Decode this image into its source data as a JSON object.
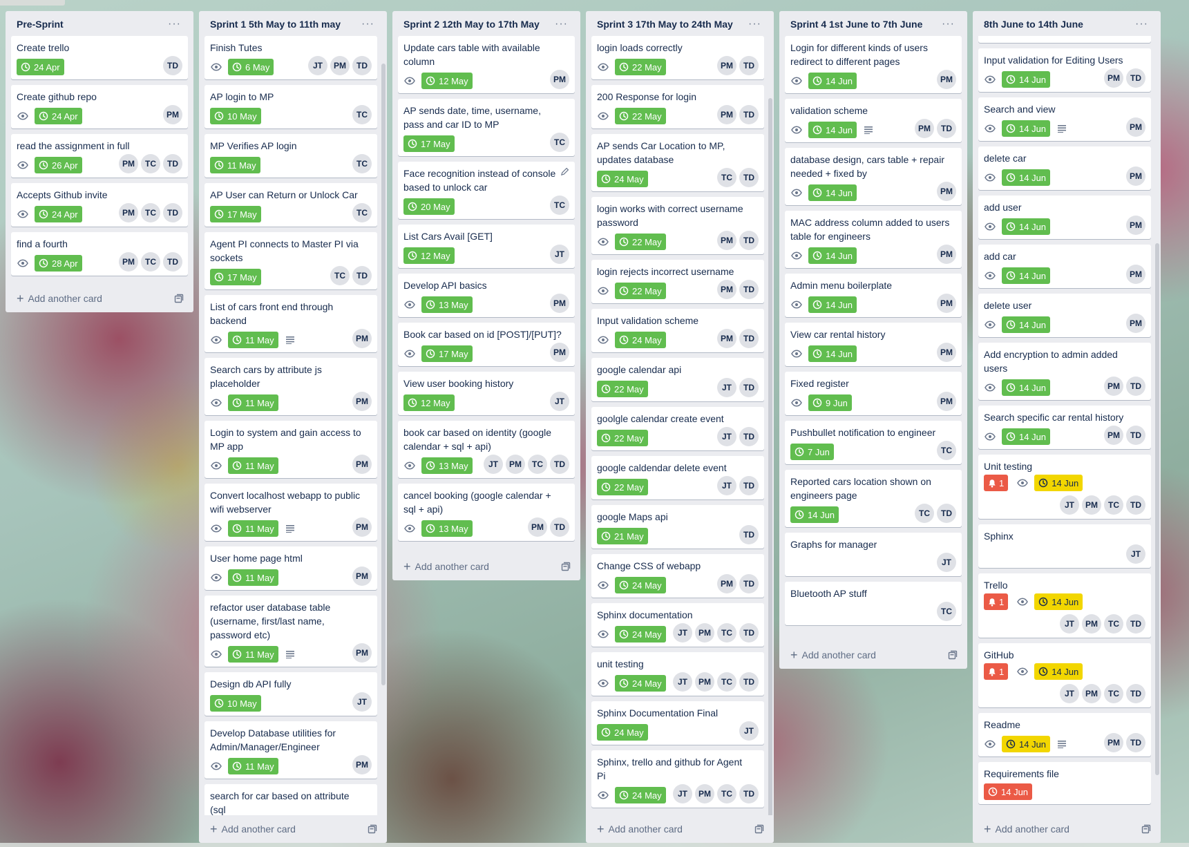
{
  "colors": {
    "list_bg": "#ebecf0",
    "due_green": "#61bd4f",
    "due_yellow": "#f2d600",
    "due_red": "#eb5a46",
    "member_bg": "#dfe1e6"
  },
  "add_card_label": "Add another card",
  "lists": [
    {
      "title": "Pre-Sprint",
      "cards": [
        {
          "title": "Create trello",
          "watch": false,
          "due": {
            "label": "24 Apr",
            "color": "green"
          },
          "members": [
            "TD"
          ]
        },
        {
          "title": "Create github repo",
          "watch": true,
          "due": {
            "label": "24 Apr",
            "color": "green"
          },
          "members": [
            "PM"
          ]
        },
        {
          "title": "read the assignment in full",
          "watch": true,
          "due": {
            "label": "26 Apr",
            "color": "green"
          },
          "members": [
            "PM",
            "TC",
            "TD"
          ]
        },
        {
          "title": "Accepts Github invite",
          "watch": true,
          "due": {
            "label": "24 Apr",
            "color": "green"
          },
          "members": [
            "PM",
            "TC",
            "TD"
          ]
        },
        {
          "title": "find a fourth",
          "watch": true,
          "due": {
            "label": "28 Apr",
            "color": "green"
          },
          "members": [
            "PM",
            "TC",
            "TD"
          ]
        }
      ]
    },
    {
      "title": "Sprint 1 5th May to 11th may",
      "cards": [
        {
          "title": "Finish Tutes",
          "watch": true,
          "due": {
            "label": "6 May",
            "color": "green"
          },
          "members": [
            "JT",
            "PM",
            "TD"
          ]
        },
        {
          "title": "AP login to MP",
          "watch": false,
          "due": {
            "label": "10 May",
            "color": "green"
          },
          "members": [
            "TC"
          ]
        },
        {
          "title": "MP Verifies AP login",
          "watch": false,
          "due": {
            "label": "11 May",
            "color": "green"
          },
          "members": [
            "TC"
          ]
        },
        {
          "title": "AP User can Return or Unlock Car",
          "watch": false,
          "due": {
            "label": "17 May",
            "color": "green"
          },
          "members": [
            "TC"
          ]
        },
        {
          "title": "Agent PI connects to Master PI via sockets",
          "watch": false,
          "due": {
            "label": "17 May",
            "color": "green"
          },
          "members": [
            "TC",
            "TD"
          ]
        },
        {
          "title": "List of cars front end through backend",
          "watch": true,
          "due": {
            "label": "11 May",
            "color": "green"
          },
          "desc": true,
          "members": [
            "PM"
          ]
        },
        {
          "title": "Search cars by attribute js placeholder",
          "watch": true,
          "due": {
            "label": "11 May",
            "color": "green"
          },
          "members": [
            "PM"
          ]
        },
        {
          "title": "Login to system and gain access to MP app",
          "watch": true,
          "due": {
            "label": "11 May",
            "color": "green"
          },
          "members": [
            "PM"
          ]
        },
        {
          "title": "Convert localhost webapp to public wifi webserver",
          "watch": true,
          "due": {
            "label": "11 May",
            "color": "green"
          },
          "desc": true,
          "members": [
            "PM"
          ]
        },
        {
          "title": "User home page html",
          "watch": true,
          "due": {
            "label": "11 May",
            "color": "green"
          },
          "members": [
            "PM"
          ]
        },
        {
          "title": "refactor user database table (username, first/last name, password etc)",
          "watch": true,
          "due": {
            "label": "11 May",
            "color": "green"
          },
          "desc": true,
          "members": [
            "PM"
          ]
        },
        {
          "title": "Design db API fully",
          "watch": false,
          "due": {
            "label": "10 May",
            "color": "green"
          },
          "members": [
            "JT"
          ]
        },
        {
          "title": "Develop Database utilities for Admin/Manager/Engineer",
          "watch": true,
          "due": {
            "label": "11 May",
            "color": "green"
          },
          "members": [
            "PM"
          ]
        },
        {
          "title": "search for car based on attribute (sql",
          "watch": false,
          "members": []
        }
      ]
    },
    {
      "title": "Sprint 2 12th May to 17th May",
      "cards": [
        {
          "title": "Update cars table with available column",
          "watch": true,
          "due": {
            "label": "12 May",
            "color": "green"
          },
          "members": [
            "PM"
          ]
        },
        {
          "title": "AP sends date, time, username, pass and car ID to MP",
          "watch": false,
          "due": {
            "label": "17 May",
            "color": "green"
          },
          "members": [
            "TC"
          ]
        },
        {
          "title": "Face recognition instead of console based to unlock car",
          "watch": false,
          "due": {
            "label": "20 May",
            "color": "green"
          },
          "members": [
            "TC"
          ],
          "editing": true
        },
        {
          "title": "List Cars Avail [GET]",
          "watch": false,
          "due": {
            "label": "12 May",
            "color": "green"
          },
          "members": [
            "JT"
          ]
        },
        {
          "title": "Develop API basics",
          "watch": true,
          "due": {
            "label": "13 May",
            "color": "green"
          },
          "members": [
            "PM"
          ]
        },
        {
          "title": "Book car based on id [POST]/[PUT]?",
          "watch": true,
          "due": {
            "label": "17 May",
            "color": "green"
          },
          "members": [
            "PM"
          ]
        },
        {
          "title": "View user booking history",
          "watch": false,
          "due": {
            "label": "12 May",
            "color": "green"
          },
          "members": [
            "JT"
          ]
        },
        {
          "title": "book car based on identity (google calendar + sql + api)",
          "watch": true,
          "due": {
            "label": "13 May",
            "color": "green"
          },
          "members": [
            "JT",
            "PM",
            "TC",
            "TD"
          ]
        },
        {
          "title": "cancel booking (google calendar + sql + api)",
          "watch": true,
          "due": {
            "label": "13 May",
            "color": "green"
          },
          "members": [
            "PM",
            "TD"
          ]
        }
      ]
    },
    {
      "title": "Sprint 3 17th May to 24th May",
      "cards": [
        {
          "title": "login loads correctly",
          "watch": true,
          "due": {
            "label": "22 May",
            "color": "green"
          },
          "members": [
            "PM",
            "TD"
          ]
        },
        {
          "title": "200 Response for login",
          "watch": true,
          "due": {
            "label": "22 May",
            "color": "green"
          },
          "members": [
            "PM",
            "TD"
          ]
        },
        {
          "title": "AP sends Car Location to MP, updates database",
          "watch": false,
          "due": {
            "label": "24 May",
            "color": "green"
          },
          "members": [
            "TC",
            "TD"
          ]
        },
        {
          "title": "login works with correct username password",
          "watch": true,
          "due": {
            "label": "22 May",
            "color": "green"
          },
          "members": [
            "PM",
            "TD"
          ]
        },
        {
          "title": "login rejects incorrect username",
          "watch": true,
          "due": {
            "label": "22 May",
            "color": "green"
          },
          "members": [
            "PM",
            "TD"
          ]
        },
        {
          "title": "Input validation scheme",
          "watch": true,
          "due": {
            "label": "24 May",
            "color": "green"
          },
          "members": [
            "PM",
            "TD"
          ]
        },
        {
          "title": "google calendar api",
          "watch": false,
          "due": {
            "label": "22 May",
            "color": "green"
          },
          "members": [
            "JT",
            "TD"
          ]
        },
        {
          "title": "goolgle calendar create event",
          "watch": false,
          "due": {
            "label": "22 May",
            "color": "green"
          },
          "members": [
            "JT",
            "TD"
          ]
        },
        {
          "title": "google caldendar delete event",
          "watch": false,
          "due": {
            "label": "22 May",
            "color": "green"
          },
          "members": [
            "JT",
            "TD"
          ]
        },
        {
          "title": "google Maps api",
          "watch": false,
          "due": {
            "label": "21 May",
            "color": "green"
          },
          "members": [
            "TD"
          ]
        },
        {
          "title": "Change CSS of webapp",
          "watch": true,
          "due": {
            "label": "24 May",
            "color": "green"
          },
          "members": [
            "PM",
            "TD"
          ]
        },
        {
          "title": "Sphinx documentation",
          "watch": true,
          "due": {
            "label": "24 May",
            "color": "green"
          },
          "members": [
            "JT",
            "PM",
            "TC",
            "TD"
          ]
        },
        {
          "title": "unit testing",
          "watch": true,
          "due": {
            "label": "24 May",
            "color": "green"
          },
          "members": [
            "JT",
            "PM",
            "TC",
            "TD"
          ]
        },
        {
          "title": "Sphinx Documentation Final",
          "watch": false,
          "due": {
            "label": "24 May",
            "color": "green"
          },
          "members": [
            "JT"
          ]
        },
        {
          "title": "Sphinx, trello and github for Agent Pi",
          "watch": true,
          "due": {
            "label": "24 May",
            "color": "green"
          },
          "members": [
            "JT",
            "PM",
            "TC",
            "TD"
          ]
        }
      ]
    },
    {
      "title": "Sprint 4 1st June to 7th June",
      "cards": [
        {
          "title": "Login for different kinds of users redirect to different pages",
          "watch": true,
          "due": {
            "label": "14 Jun",
            "color": "green"
          },
          "members": [
            "PM"
          ]
        },
        {
          "title": "validation scheme",
          "watch": true,
          "due": {
            "label": "14 Jun",
            "color": "green"
          },
          "desc": true,
          "members": [
            "PM",
            "TD"
          ]
        },
        {
          "title": "database design, cars table + repair needed + fixed by",
          "watch": true,
          "due": {
            "label": "14 Jun",
            "color": "green"
          },
          "members": [
            "PM"
          ]
        },
        {
          "title": "MAC address column added to users table for engineers",
          "watch": true,
          "due": {
            "label": "14 Jun",
            "color": "green"
          },
          "members": [
            "PM"
          ]
        },
        {
          "title": "Admin menu boilerplate",
          "watch": true,
          "due": {
            "label": "14 Jun",
            "color": "green"
          },
          "members": [
            "PM"
          ]
        },
        {
          "title": "View car rental history",
          "watch": true,
          "due": {
            "label": "14 Jun",
            "color": "green"
          },
          "members": [
            "PM"
          ]
        },
        {
          "title": "Fixed register",
          "watch": true,
          "due": {
            "label": "9 Jun",
            "color": "green"
          },
          "members": [
            "PM"
          ]
        },
        {
          "title": "Pushbullet notification to engineer",
          "watch": false,
          "due": {
            "label": "7 Jun",
            "color": "green"
          },
          "members": [
            "TC"
          ]
        },
        {
          "title": "Reported cars location shown on engineers page",
          "watch": false,
          "due": {
            "label": "14 Jun",
            "color": "green"
          },
          "members": [
            "TC",
            "TD"
          ]
        },
        {
          "title": "Graphs for manager",
          "watch": false,
          "members": [
            "JT"
          ]
        },
        {
          "title": "Bluetooth AP stuff",
          "watch": false,
          "members": [
            "TC"
          ]
        }
      ]
    },
    {
      "title": "8th June to 14th June",
      "cards": [
        {
          "title": "Input validation for Editing Users",
          "watch": true,
          "due": {
            "label": "14 Jun",
            "color": "green"
          },
          "members": [
            "PM",
            "TD"
          ]
        },
        {
          "title": "Search and view",
          "watch": true,
          "due": {
            "label": "14 Jun",
            "color": "green"
          },
          "desc": true,
          "members": [
            "PM"
          ]
        },
        {
          "title": "delete car",
          "watch": true,
          "due": {
            "label": "14 Jun",
            "color": "green"
          },
          "members": [
            "PM"
          ]
        },
        {
          "title": "add user",
          "watch": true,
          "due": {
            "label": "14 Jun",
            "color": "green"
          },
          "members": [
            "PM"
          ]
        },
        {
          "title": "add car",
          "watch": true,
          "due": {
            "label": "14 Jun",
            "color": "green"
          },
          "members": [
            "PM"
          ]
        },
        {
          "title": "delete user",
          "watch": true,
          "due": {
            "label": "14 Jun",
            "color": "green"
          },
          "members": [
            "PM"
          ]
        },
        {
          "title": "Add encryption to admin added users",
          "watch": true,
          "due": {
            "label": "14 Jun",
            "color": "green"
          },
          "members": [
            "PM",
            "TD"
          ]
        },
        {
          "title": "Search specific car rental history",
          "watch": true,
          "due": {
            "label": "14 Jun",
            "color": "green"
          },
          "members": [
            "PM",
            "TD"
          ]
        },
        {
          "title": "Unit testing",
          "bell": "1",
          "watch": true,
          "due": {
            "label": "14 Jun",
            "color": "yellow"
          },
          "members": [
            "JT",
            "PM",
            "TC",
            "TD"
          ],
          "members_block": true
        },
        {
          "title": "Sphinx",
          "watch": false,
          "members": [
            "JT"
          ]
        },
        {
          "title": "Trello",
          "bell": "1",
          "watch": true,
          "due": {
            "label": "14 Jun",
            "color": "yellow"
          },
          "members": [
            "JT",
            "PM",
            "TC",
            "TD"
          ],
          "members_block": true
        },
        {
          "title": "GitHub",
          "bell": "1",
          "watch": true,
          "due": {
            "label": "14 Jun",
            "color": "yellow"
          },
          "members": [
            "JT",
            "PM",
            "TC",
            "TD"
          ],
          "members_block": true
        },
        {
          "title": "Readme",
          "watch": true,
          "due": {
            "label": "14 Jun",
            "color": "yellow"
          },
          "desc": true,
          "members": [
            "PM",
            "TD"
          ]
        },
        {
          "title": "Requirements file",
          "watch": false,
          "due": {
            "label": "14 Jun",
            "color": "red"
          },
          "members": []
        }
      ]
    }
  ]
}
